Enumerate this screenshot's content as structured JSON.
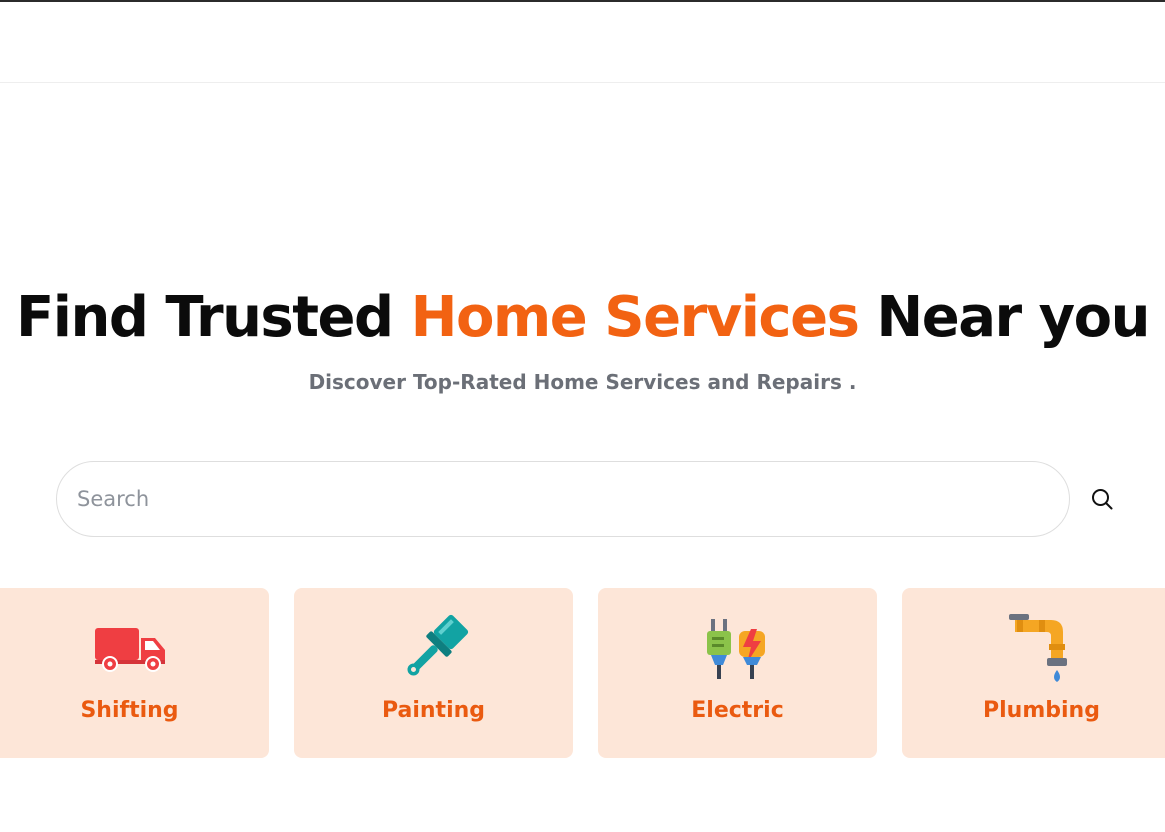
{
  "hero": {
    "title_part1": "Find Trusted ",
    "title_accent": "Home Services",
    "title_part2": " Near you",
    "subtitle": "Discover Top-Rated Home Services and Repairs ."
  },
  "search": {
    "placeholder": "Search",
    "value": "",
    "button_icon": "search-icon"
  },
  "categories": [
    {
      "label": "Shifting",
      "icon": "truck-icon"
    },
    {
      "label": "Painting",
      "icon": "paintbrush-icon"
    },
    {
      "label": "Electric",
      "icon": "electric-plug-icon"
    },
    {
      "label": "Plumbing",
      "icon": "pipe-icon"
    }
  ],
  "colors": {
    "accent": "#f26212",
    "card_bg": "#fde6d8",
    "card_label": "#ea5a10",
    "subtitle": "#6b6f77"
  }
}
